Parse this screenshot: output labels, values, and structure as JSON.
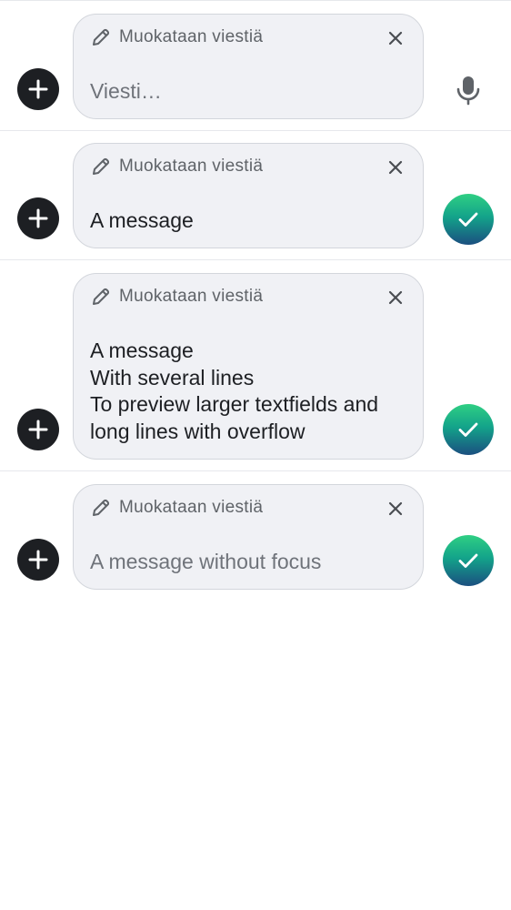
{
  "editing_label": "Muokataan viestiä",
  "composers": [
    {
      "text": "Viesti…",
      "is_placeholder": true,
      "action": "mic"
    },
    {
      "text": "A message",
      "is_placeholder": false,
      "action": "send"
    },
    {
      "text": "A message\nWith several lines\nTo preview larger textfields and\nlong lines with overflow",
      "is_placeholder": false,
      "action": "send"
    },
    {
      "text": "A message without focus",
      "is_placeholder": true,
      "action": "send"
    }
  ],
  "icons": {
    "attach": "plus-icon",
    "edit": "pencil-icon",
    "cancel": "close-icon",
    "voice": "microphone-icon",
    "send": "checkmark-icon"
  },
  "colors": {
    "composer_bg": "#f0f1f5",
    "attach_button": "#1d1f23",
    "send_gradient_top": "#2fcf83",
    "send_gradient_bottom": "#1b4f80"
  }
}
